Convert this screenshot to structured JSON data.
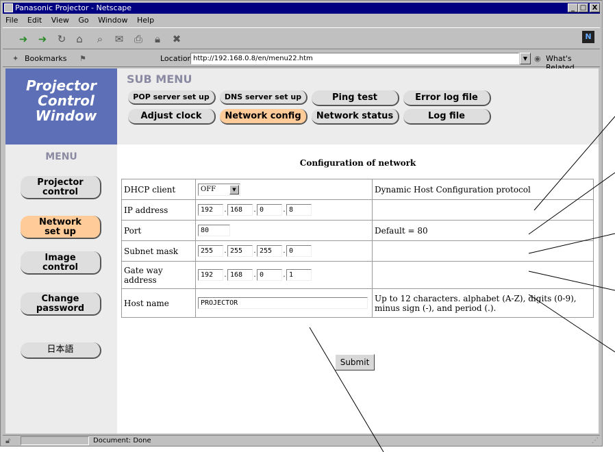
{
  "window": {
    "title": "Panasonic Projector - Netscape",
    "min": "_",
    "max": "□",
    "close": "X"
  },
  "menubar": [
    "File",
    "Edit",
    "View",
    "Go",
    "Window",
    "Help"
  ],
  "toolbar": {
    "icons": [
      "back-icon",
      "forward-icon",
      "reload-icon",
      "home-icon",
      "search-icon",
      "mail-icon",
      "print-icon",
      "security-icon",
      "stop-icon"
    ],
    "throbber": "N"
  },
  "location": {
    "bookmarks_label": "Bookmarks",
    "location_label": "Location:",
    "url": "http://192.168.0.8/en/menu22.htm",
    "related": "What's Related"
  },
  "brand": {
    "line1": "Projector",
    "line2": "Control",
    "line3": "Window"
  },
  "submenu": {
    "title": "SUB MENU",
    "row1": [
      "POP server set up",
      "DNS server set up",
      "Ping test",
      "Error log file"
    ],
    "row2": [
      "Adjust clock",
      "Network config",
      "Network status",
      "Log file"
    ]
  },
  "leftnav": {
    "title": "MENU",
    "projector": [
      "Projector",
      "control"
    ],
    "network": [
      "Network",
      "set up"
    ],
    "image": [
      "Image",
      "control"
    ],
    "password": [
      "Change",
      "password"
    ],
    "japanese": "日本語"
  },
  "page_title": "Configuration of network",
  "form": {
    "dhcp": {
      "label": "DHCP client",
      "value": "OFF",
      "desc": "Dynamic Host Configuration protocol"
    },
    "ip": {
      "label": "IP address",
      "o1": "192",
      "o2": "168",
      "o3": "0",
      "o4": "8"
    },
    "port": {
      "label": "Port",
      "value": "80",
      "desc": "Default = 80"
    },
    "subnet": {
      "label": "Subnet mask",
      "o1": "255",
      "o2": "255",
      "o3": "255",
      "o4": "0"
    },
    "gateway": {
      "label1": "Gate way",
      "label2": "address",
      "o1": "192",
      "o2": "168",
      "o3": "0",
      "o4": "1"
    },
    "host": {
      "label": "Host name",
      "value": "PROJECTOR",
      "desc1": "Up to 12 characters. alphabet (A-Z), digits (0-9),",
      "desc2": "minus sign (-), and period (.)."
    },
    "submit": "Submit"
  },
  "status": {
    "text": "Document: Done"
  }
}
